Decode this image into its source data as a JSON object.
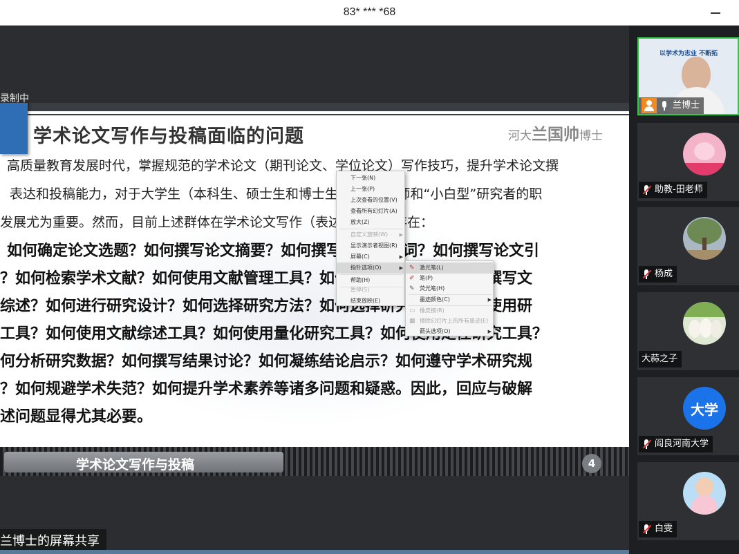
{
  "window": {
    "title": "83* *** *68"
  },
  "share": {
    "recording_label": "录制中",
    "share_label": "兰博士的屏幕共享"
  },
  "slide": {
    "heading": "学术论文写作与投稿面临的问题",
    "author_prefix": "河大",
    "author_name": "兰国帅",
    "author_suffix": "博士",
    "paragraph_lines": [
      "高质量教育发展时代，掌握规范的学术论文（期刊论文、学位论文）写作技巧，提升学术论文撰",
      "表达和投稿能力，对于大学生（本科生、硕士生和博士生）、青年教师和“小白型”研究者的职",
      "发展尤为重要。然而，目前上述群体在学术论文写作（表达）中普遍存在："
    ],
    "bold_lines": [
      "如何确定论文选题？如何撰写论文摘要？如何撰写论文关键词？如何撰写论文引",
      "？如何检索学术文献？如何使用文献管理工具？如何撰写文献综述？如何撰写文",
      "综述？如何进行研究设计？如何选择研究方法？如何选择研究工具？如何使用研",
      "工具？如何使用文献综述工具？如何使用量化研究工具？如何使用定性研究工具？",
      "何分析研究数据？如何撰写结果讨论？如何凝练结论启示？如何遵守学术研究规",
      "？如何规避学术失范？如何提升学术素养等诸多问题和疑惑。因此，回应与破解",
      "述问题显得尤其必要。"
    ],
    "footer_title": "学术论文写作与投稿",
    "page_number": "4"
  },
  "context_menu": {
    "items": [
      {
        "label": "下一张(N)",
        "disabled": false,
        "arrow": false
      },
      {
        "label": "上一张(P)",
        "disabled": false,
        "arrow": false
      },
      {
        "label": "上次查看的位置(V)",
        "disabled": false,
        "arrow": false
      },
      {
        "label": "查看所有幻灯片(A)",
        "disabled": false,
        "arrow": false
      },
      {
        "label": "放大(Z)",
        "disabled": false,
        "arrow": false
      },
      {
        "label": "自定义放映(W)",
        "disabled": true,
        "arrow": true
      },
      {
        "label": "显示演示者视图(R)",
        "disabled": false,
        "arrow": false
      },
      {
        "label": "屏幕(C)",
        "disabled": false,
        "arrow": true
      },
      {
        "label": "指针选项(O)",
        "disabled": false,
        "arrow": true,
        "highlighted": true
      },
      {
        "label": "帮助(H)",
        "disabled": false,
        "arrow": false
      },
      {
        "label": "暂停(S)",
        "disabled": true,
        "arrow": false
      },
      {
        "label": "结束放映(E)",
        "disabled": false,
        "arrow": false
      }
    ]
  },
  "pointer_submenu": {
    "items": [
      {
        "label": "激光笔(L)",
        "icon": "laser-icon",
        "highlighted": true
      },
      {
        "label": "笔(P)",
        "icon": "pen-icon"
      },
      {
        "label": "荧光笔(H)",
        "icon": "highlighter-icon"
      },
      {
        "label": "墨迹颜色(C)",
        "icon": "",
        "arrow": true
      },
      {
        "label": "橡皮擦(R)",
        "icon": "",
        "disabled": true
      },
      {
        "label": "擦除幻灯片上的所有墨迹(E)",
        "icon": "",
        "disabled": true
      },
      {
        "label": "箭头选项(O)",
        "icon": "",
        "arrow": true
      }
    ]
  },
  "participants": [
    {
      "name": "兰博士",
      "muted": false,
      "active": true,
      "avatar": "video-feed",
      "color": "#dfe6ee"
    },
    {
      "name": "助教-田老师",
      "muted": true,
      "avatar": "cartoon-pig",
      "color": "#f3b3c8"
    },
    {
      "name": "杨成",
      "muted": true,
      "avatar": "tree-photo",
      "color": "#7e9a6a"
    },
    {
      "name": "大蒜之子",
      "muted": false,
      "avatar": "garlic-photo",
      "color": "#e7ede0"
    },
    {
      "name": "阎良河南大学",
      "muted": true,
      "avatar": "text-avatar",
      "avatar_text": "大学",
      "color": "#1a73e8"
    },
    {
      "name": "白雯",
      "muted": true,
      "avatar": "child-photo",
      "color": "#a8d4f0"
    }
  ],
  "video_banner_text": "以学术为志业 不断拓"
}
